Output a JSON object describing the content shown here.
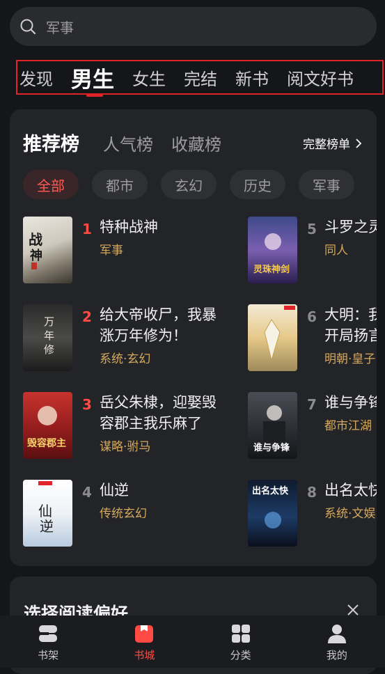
{
  "search": {
    "placeholder": "军事"
  },
  "nav": {
    "tabs": [
      "发现",
      "男生",
      "女生",
      "完结",
      "新书",
      "阅文好书"
    ],
    "active": "男生"
  },
  "ranking": {
    "tabs": [
      "推荐榜",
      "人气榜",
      "收藏榜"
    ],
    "full_list": "完整榜单",
    "chips": [
      "全部",
      "都市",
      "玄幻",
      "历史",
      "军事"
    ],
    "books_left": [
      {
        "rank": "1",
        "title": "特种战神",
        "title2": "",
        "tag": "军事"
      },
      {
        "rank": "2",
        "title": "给大帝收尸，我暴",
        "title2": "涨万年修为！",
        "tag": "系统·玄幻"
      },
      {
        "rank": "3",
        "title": "岳父朱棣，迎娶毁",
        "title2": "容郡主我乐麻了",
        "tag": "谋略·驸马"
      },
      {
        "rank": "4",
        "title": "仙逆",
        "title2": "",
        "tag": "传统玄幻"
      }
    ],
    "books_right": [
      {
        "rank": "5",
        "title": "斗罗之灵",
        "title2": "",
        "tag": "同人"
      },
      {
        "rank": "6",
        "title": "大明：我",
        "title2": "开局扬言",
        "tag": "明朝·皇子"
      },
      {
        "rank": "7",
        "title": "谁与争锋",
        "title2": "",
        "tag": "都市江湖"
      },
      {
        "rank": "8",
        "title": "出名太快",
        "title2": "",
        "tag": "系统·文娱"
      }
    ]
  },
  "preference": {
    "title": "选择阅读偏好"
  },
  "bottom_nav": [
    {
      "label": "书架",
      "icon": "bookshelf-icon"
    },
    {
      "label": "书城",
      "icon": "bookstore-icon"
    },
    {
      "label": "分类",
      "icon": "category-grid-icon"
    },
    {
      "label": "我的",
      "icon": "profile-icon"
    }
  ],
  "colors": {
    "accent": "#ff4b44",
    "tag": "#d4a95d",
    "bg": "#15161a",
    "card": "#232428"
  }
}
